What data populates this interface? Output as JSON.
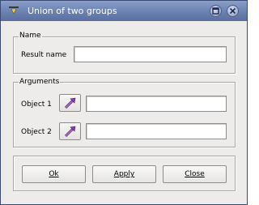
{
  "window": {
    "title": "Union of two groups"
  },
  "icons": {
    "title": "app-menu-icon",
    "maximize": "maximize-icon",
    "close": "close-icon",
    "select": "arrow-select-icon"
  },
  "colors": {
    "titlebar": "#6b81b0",
    "dialog_bg": "#edeceb",
    "select_arrow": "#8e3ab0"
  },
  "name_group": {
    "legend": "Name",
    "result_label": "Result name",
    "result_value": ""
  },
  "arguments_group": {
    "legend": "Arguments",
    "object1_label": "Object 1",
    "object1_value": "",
    "object2_label": "Object 2",
    "object2_value": ""
  },
  "buttons": {
    "ok": "Ok",
    "apply": "Apply",
    "close": "Close"
  }
}
